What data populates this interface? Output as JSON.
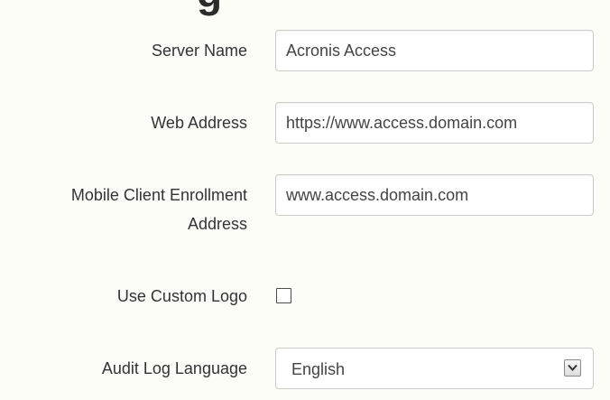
{
  "page": {
    "heading": "g"
  },
  "form": {
    "server_name": {
      "label": "Server Name",
      "value": "Acronis Access"
    },
    "web_address": {
      "label": "Web Address",
      "value": "https://www.access.domain.com"
    },
    "mobile_enrollment_address": {
      "label_line1": "Mobile Client Enrollment",
      "label_line2": "Address",
      "value": "www.access.domain.com"
    },
    "use_custom_logo": {
      "label": "Use Custom Logo",
      "checked": false
    },
    "audit_log_language": {
      "label": "Audit Log Language",
      "selected": "English",
      "icon": "chevron-down-icon"
    }
  },
  "colors": {
    "background": "#fdfdf8",
    "text": "#333333",
    "field_border": "#cccccc"
  }
}
